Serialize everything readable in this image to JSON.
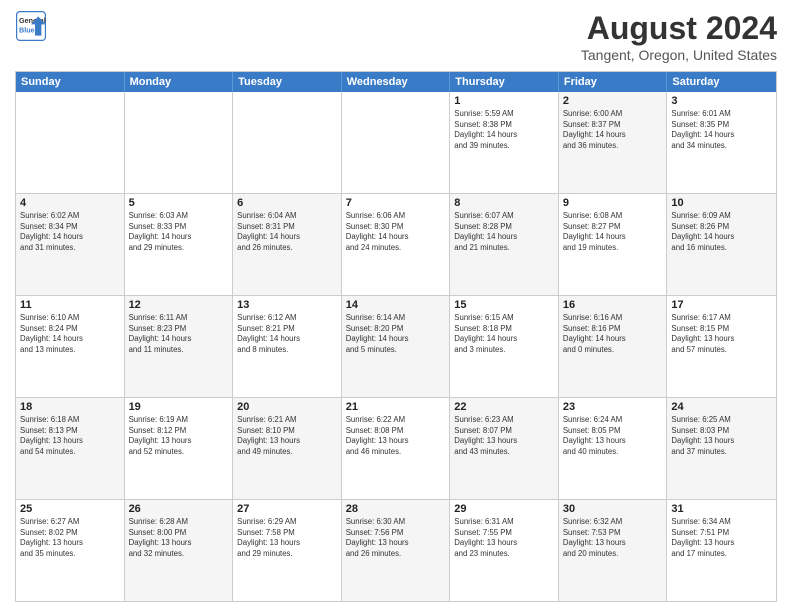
{
  "header": {
    "logo_line1": "General",
    "logo_line2": "Blue",
    "title": "August 2024",
    "subtitle": "Tangent, Oregon, United States"
  },
  "days_of_week": [
    "Sunday",
    "Monday",
    "Tuesday",
    "Wednesday",
    "Thursday",
    "Friday",
    "Saturday"
  ],
  "rows": [
    [
      {
        "day": "",
        "info": ""
      },
      {
        "day": "",
        "info": ""
      },
      {
        "day": "",
        "info": ""
      },
      {
        "day": "",
        "info": ""
      },
      {
        "day": "1",
        "info": "Sunrise: 5:59 AM\nSunset: 8:38 PM\nDaylight: 14 hours\nand 39 minutes."
      },
      {
        "day": "2",
        "info": "Sunrise: 6:00 AM\nSunset: 8:37 PM\nDaylight: 14 hours\nand 36 minutes."
      },
      {
        "day": "3",
        "info": "Sunrise: 6:01 AM\nSunset: 8:35 PM\nDaylight: 14 hours\nand 34 minutes."
      }
    ],
    [
      {
        "day": "4",
        "info": "Sunrise: 6:02 AM\nSunset: 8:34 PM\nDaylight: 14 hours\nand 31 minutes."
      },
      {
        "day": "5",
        "info": "Sunrise: 6:03 AM\nSunset: 8:33 PM\nDaylight: 14 hours\nand 29 minutes."
      },
      {
        "day": "6",
        "info": "Sunrise: 6:04 AM\nSunset: 8:31 PM\nDaylight: 14 hours\nand 26 minutes."
      },
      {
        "day": "7",
        "info": "Sunrise: 6:06 AM\nSunset: 8:30 PM\nDaylight: 14 hours\nand 24 minutes."
      },
      {
        "day": "8",
        "info": "Sunrise: 6:07 AM\nSunset: 8:28 PM\nDaylight: 14 hours\nand 21 minutes."
      },
      {
        "day": "9",
        "info": "Sunrise: 6:08 AM\nSunset: 8:27 PM\nDaylight: 14 hours\nand 19 minutes."
      },
      {
        "day": "10",
        "info": "Sunrise: 6:09 AM\nSunset: 8:26 PM\nDaylight: 14 hours\nand 16 minutes."
      }
    ],
    [
      {
        "day": "11",
        "info": "Sunrise: 6:10 AM\nSunset: 8:24 PM\nDaylight: 14 hours\nand 13 minutes."
      },
      {
        "day": "12",
        "info": "Sunrise: 6:11 AM\nSunset: 8:23 PM\nDaylight: 14 hours\nand 11 minutes."
      },
      {
        "day": "13",
        "info": "Sunrise: 6:12 AM\nSunset: 8:21 PM\nDaylight: 14 hours\nand 8 minutes."
      },
      {
        "day": "14",
        "info": "Sunrise: 6:14 AM\nSunset: 8:20 PM\nDaylight: 14 hours\nand 5 minutes."
      },
      {
        "day": "15",
        "info": "Sunrise: 6:15 AM\nSunset: 8:18 PM\nDaylight: 14 hours\nand 3 minutes."
      },
      {
        "day": "16",
        "info": "Sunrise: 6:16 AM\nSunset: 8:16 PM\nDaylight: 14 hours\nand 0 minutes."
      },
      {
        "day": "17",
        "info": "Sunrise: 6:17 AM\nSunset: 8:15 PM\nDaylight: 13 hours\nand 57 minutes."
      }
    ],
    [
      {
        "day": "18",
        "info": "Sunrise: 6:18 AM\nSunset: 8:13 PM\nDaylight: 13 hours\nand 54 minutes."
      },
      {
        "day": "19",
        "info": "Sunrise: 6:19 AM\nSunset: 8:12 PM\nDaylight: 13 hours\nand 52 minutes."
      },
      {
        "day": "20",
        "info": "Sunrise: 6:21 AM\nSunset: 8:10 PM\nDaylight: 13 hours\nand 49 minutes."
      },
      {
        "day": "21",
        "info": "Sunrise: 6:22 AM\nSunset: 8:08 PM\nDaylight: 13 hours\nand 46 minutes."
      },
      {
        "day": "22",
        "info": "Sunrise: 6:23 AM\nSunset: 8:07 PM\nDaylight: 13 hours\nand 43 minutes."
      },
      {
        "day": "23",
        "info": "Sunrise: 6:24 AM\nSunset: 8:05 PM\nDaylight: 13 hours\nand 40 minutes."
      },
      {
        "day": "24",
        "info": "Sunrise: 6:25 AM\nSunset: 8:03 PM\nDaylight: 13 hours\nand 37 minutes."
      }
    ],
    [
      {
        "day": "25",
        "info": "Sunrise: 6:27 AM\nSunset: 8:02 PM\nDaylight: 13 hours\nand 35 minutes."
      },
      {
        "day": "26",
        "info": "Sunrise: 6:28 AM\nSunset: 8:00 PM\nDaylight: 13 hours\nand 32 minutes."
      },
      {
        "day": "27",
        "info": "Sunrise: 6:29 AM\nSunset: 7:58 PM\nDaylight: 13 hours\nand 29 minutes."
      },
      {
        "day": "28",
        "info": "Sunrise: 6:30 AM\nSunset: 7:56 PM\nDaylight: 13 hours\nand 26 minutes."
      },
      {
        "day": "29",
        "info": "Sunrise: 6:31 AM\nSunset: 7:55 PM\nDaylight: 13 hours\nand 23 minutes."
      },
      {
        "day": "30",
        "info": "Sunrise: 6:32 AM\nSunset: 7:53 PM\nDaylight: 13 hours\nand 20 minutes."
      },
      {
        "day": "31",
        "info": "Sunrise: 6:34 AM\nSunset: 7:51 PM\nDaylight: 13 hours\nand 17 minutes."
      }
    ]
  ]
}
